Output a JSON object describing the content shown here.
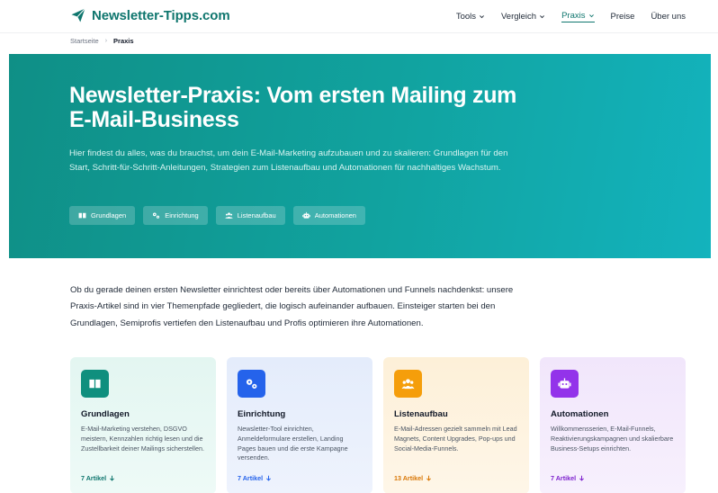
{
  "brand": {
    "name": "Newsletter-Tipps.com",
    "color": "#0f766e"
  },
  "nav": {
    "items": [
      {
        "label": "Tools",
        "dropdown": true,
        "active": false
      },
      {
        "label": "Vergleich",
        "dropdown": true,
        "active": false
      },
      {
        "label": "Praxis",
        "dropdown": true,
        "active": true
      },
      {
        "label": "Preise",
        "dropdown": false,
        "active": false
      },
      {
        "label": "Über uns",
        "dropdown": false,
        "active": false
      }
    ]
  },
  "breadcrumb": {
    "home": "Startseite",
    "separator": "›",
    "current": "Praxis"
  },
  "hero": {
    "title": "Newsletter-Praxis: Vom ersten Mailing zum E-Mail-Business",
    "description": "Hier findest du alles, was du brauchst, um dein E-Mail-Marketing aufzubauen und zu skalieren: Grundlagen für den Start, Schritt-für-Schritt-Anleitungen, Strategien zum Listenaufbau und Automationen für nachhaltiges Wachstum.",
    "pills": [
      {
        "label": "Grundlagen",
        "icon": "book-icon"
      },
      {
        "label": "Einrichtung",
        "icon": "gears-icon"
      },
      {
        "label": "Listenaufbau",
        "icon": "users-icon"
      },
      {
        "label": "Automationen",
        "icon": "robot-icon"
      }
    ]
  },
  "intro": "Ob du gerade deinen ersten Newsletter einrichtest oder bereits über Automationen und Funnels nachdenkst: unsere Praxis-Artikel sind in vier Themenpfade gegliedert, die logisch aufeinander aufbauen. Einsteiger starten bei den Grundlagen, Semiprofis vertiefen den Listenaufbau und Profis optimieren ihre Automationen.",
  "cards": [
    {
      "title": "Grundlagen",
      "desc": "E-Mail-Marketing verstehen, DSGVO meistern, Kennzahlen richtig lesen und die Zustellbarkeit deiner Mailings sicherstellen.",
      "link": "7 Artikel",
      "icon": "book-icon",
      "icon_bg": "#0f8f7e",
      "link_color": "#0f766e"
    },
    {
      "title": "Einrichtung",
      "desc": "Newsletter-Tool einrichten, Anmeldeformulare erstellen, Landing Pages bauen und die erste Kampagne versenden.",
      "link": "7 Artikel",
      "icon": "gears-icon",
      "icon_bg": "#2563eb",
      "link_color": "#2563eb"
    },
    {
      "title": "Listenaufbau",
      "desc": "E-Mail-Adressen gezielt sammeln mit Lead Magnets, Content Upgrades, Pop-ups und Social-Media-Funnels.",
      "link": "13 Artikel",
      "icon": "users-icon",
      "icon_bg": "#f59e0b",
      "link_color": "#d97706"
    },
    {
      "title": "Automationen",
      "desc": "Willkommensserien, E-Mail-Funnels, Reaktivierungskampagnen und skalierbare Business-Setups einrichten.",
      "link": "7 Artikel",
      "icon": "robot-icon",
      "icon_bg": "#9333ea",
      "link_color": "#7e22ce"
    }
  ]
}
